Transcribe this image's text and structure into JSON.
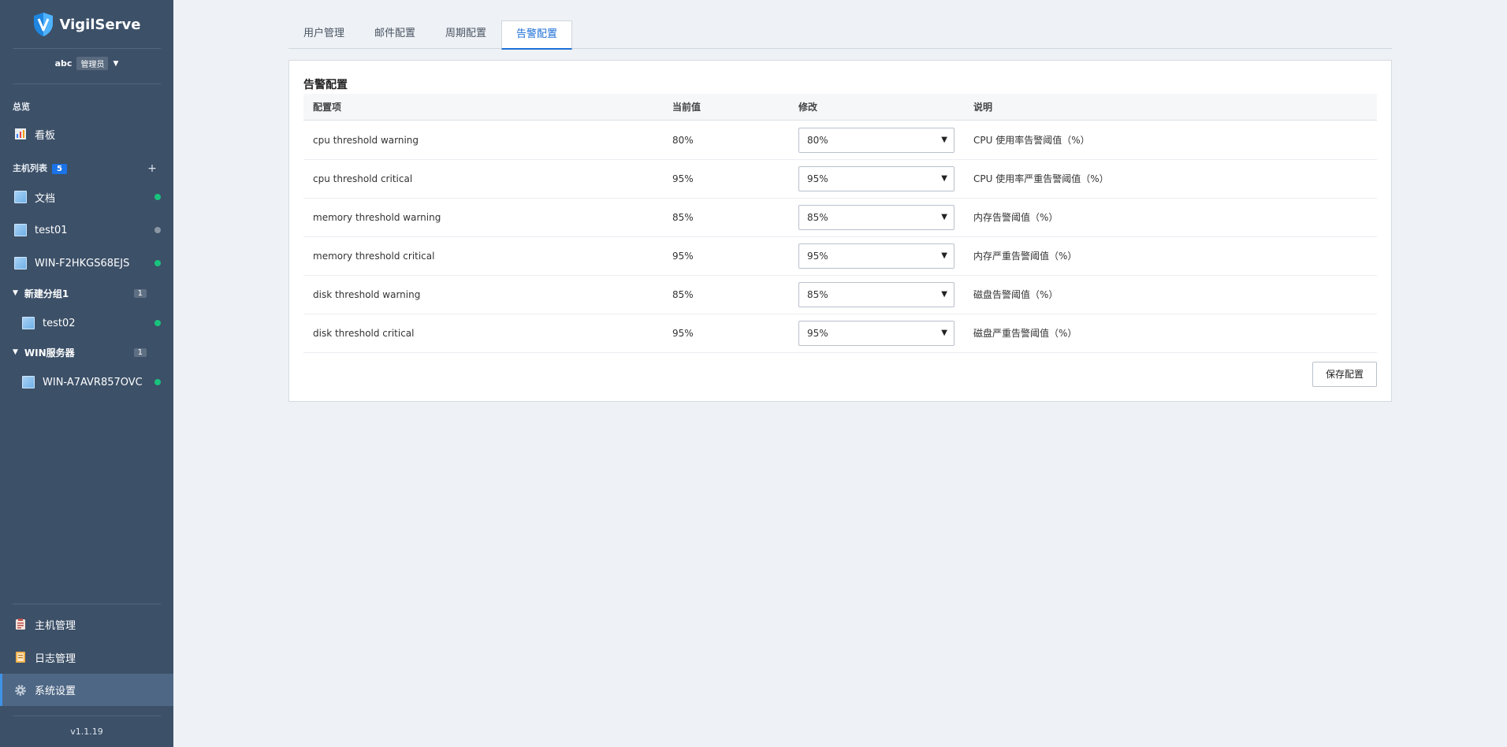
{
  "app": {
    "name": "VigilServe",
    "version": "v1.1.19"
  },
  "user": {
    "name": "abc",
    "role": "管理员"
  },
  "sidebar": {
    "overview_label": "总览",
    "dashboard_label": "看板",
    "hosts_label": "主机列表",
    "hosts_count": "5",
    "add_symbol": "+",
    "hosts": [
      {
        "name": "文档",
        "status": "online"
      },
      {
        "name": "test01",
        "status": "offline"
      },
      {
        "name": "WIN-F2HKGS68EJS",
        "status": "online"
      }
    ],
    "groups": [
      {
        "name": "新建分组1",
        "count": "1",
        "hosts": [
          {
            "name": "test02",
            "status": "online"
          }
        ]
      },
      {
        "name": "WIN服务器",
        "count": "1",
        "hosts": [
          {
            "name": "WIN-A7AVR857OVC",
            "status": "online"
          }
        ]
      }
    ],
    "bottom_items": [
      {
        "label": "主机管理",
        "icon": "clipboard-icon"
      },
      {
        "label": "日志管理",
        "icon": "log-book-icon"
      },
      {
        "label": "系统设置",
        "icon": "gear-icon",
        "active": true
      }
    ]
  },
  "tabs": [
    {
      "label": "用户管理"
    },
    {
      "label": "邮件配置"
    },
    {
      "label": "周期配置"
    },
    {
      "label": "告警配置",
      "active": true
    }
  ],
  "panel": {
    "title": "告警配置",
    "columns": [
      "配置项",
      "当前值",
      "修改",
      "说明"
    ],
    "rows": [
      {
        "item": "cpu threshold warning",
        "current": "80%",
        "selected": "80%",
        "desc": "CPU 使用率告警阈值（%）"
      },
      {
        "item": "cpu threshold critical",
        "current": "95%",
        "selected": "95%",
        "desc": "CPU 使用率严重告警阈值（%）"
      },
      {
        "item": "memory threshold warning",
        "current": "85%",
        "selected": "85%",
        "desc": "内存告警阈值（%）"
      },
      {
        "item": "memory threshold critical",
        "current": "95%",
        "selected": "95%",
        "desc": "内存严重告警阈值（%）"
      },
      {
        "item": "disk threshold warning",
        "current": "85%",
        "selected": "85%",
        "desc": "磁盘告警阈值（%）"
      },
      {
        "item": "disk threshold critical",
        "current": "95%",
        "selected": "95%",
        "desc": "磁盘严重告警阈值（%）"
      }
    ],
    "save_label": "保存配置"
  },
  "colors": {
    "sidebar_bg": "#3c5068",
    "accent": "#1e6fd6",
    "online": "#19c37d",
    "offline": "#8a96a3"
  }
}
